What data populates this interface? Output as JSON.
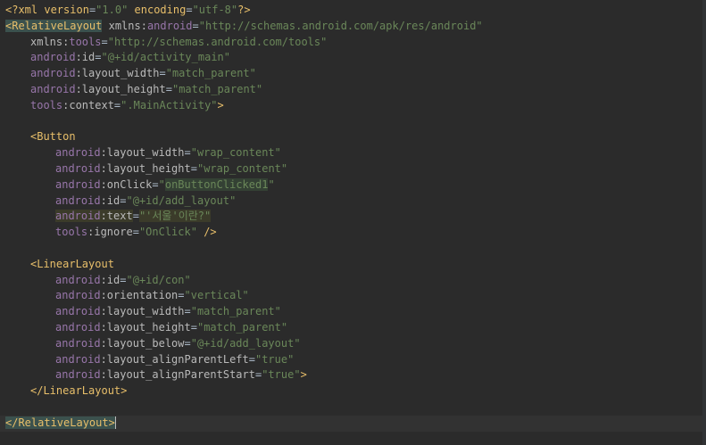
{
  "editor": {
    "lines": [
      {
        "indent": 0,
        "tokens": [
          {
            "t": "<?",
            "c": "c-decl"
          },
          {
            "t": "xml version",
            "c": "c-decl"
          },
          {
            "t": "=",
            "c": "c-eq"
          },
          {
            "t": "\"1.0\"",
            "c": "c-str"
          },
          {
            "t": " encoding",
            "c": "c-decl"
          },
          {
            "t": "=",
            "c": "c-eq"
          },
          {
            "t": "\"utf-8\"",
            "c": "c-str"
          },
          {
            "t": "?>",
            "c": "c-decl"
          }
        ]
      },
      {
        "indent": 0,
        "tokens": [
          {
            "t": "<RelativeLayout",
            "c": "c-tag hl-tag"
          },
          {
            "t": " xmlns:",
            "c": "c-attr"
          },
          {
            "t": "android",
            "c": "c-ns"
          },
          {
            "t": "=",
            "c": "c-eq"
          },
          {
            "t": "\"http://schemas.android.com/apk/res/android\"",
            "c": "c-str"
          }
        ]
      },
      {
        "indent": 1,
        "tokens": [
          {
            "t": "xmlns:",
            "c": "c-attr"
          },
          {
            "t": "tools",
            "c": "c-ns"
          },
          {
            "t": "=",
            "c": "c-eq"
          },
          {
            "t": "\"http://schemas.android.com/tools\"",
            "c": "c-str"
          }
        ]
      },
      {
        "indent": 1,
        "tokens": [
          {
            "t": "android",
            "c": "c-ns"
          },
          {
            "t": ":id",
            "c": "c-attr"
          },
          {
            "t": "=",
            "c": "c-eq"
          },
          {
            "t": "\"@+id/activity_main\"",
            "c": "c-str"
          }
        ]
      },
      {
        "indent": 1,
        "tokens": [
          {
            "t": "android",
            "c": "c-ns"
          },
          {
            "t": ":layout_width",
            "c": "c-attr"
          },
          {
            "t": "=",
            "c": "c-eq"
          },
          {
            "t": "\"match_parent\"",
            "c": "c-str"
          }
        ]
      },
      {
        "indent": 1,
        "tokens": [
          {
            "t": "android",
            "c": "c-ns"
          },
          {
            "t": ":layout_height",
            "c": "c-attr"
          },
          {
            "t": "=",
            "c": "c-eq"
          },
          {
            "t": "\"match_parent\"",
            "c": "c-str"
          }
        ]
      },
      {
        "indent": 1,
        "tokens": [
          {
            "t": "tools",
            "c": "c-ns"
          },
          {
            "t": ":context",
            "c": "c-attr"
          },
          {
            "t": "=",
            "c": "c-eq"
          },
          {
            "t": "\".MainActivity\"",
            "c": "c-str"
          },
          {
            "t": ">",
            "c": "c-punct"
          }
        ]
      },
      {
        "indent": 0,
        "tokens": []
      },
      {
        "indent": 1,
        "tokens": [
          {
            "t": "<Button",
            "c": "c-tag"
          }
        ]
      },
      {
        "indent": 2,
        "tokens": [
          {
            "t": "android",
            "c": "c-ns"
          },
          {
            "t": ":layout_width",
            "c": "c-attr"
          },
          {
            "t": "=",
            "c": "c-eq"
          },
          {
            "t": "\"wrap_content\"",
            "c": "c-str"
          }
        ]
      },
      {
        "indent": 2,
        "tokens": [
          {
            "t": "android",
            "c": "c-ns"
          },
          {
            "t": ":layout_height",
            "c": "c-attr"
          },
          {
            "t": "=",
            "c": "c-eq"
          },
          {
            "t": "\"wrap_content\"",
            "c": "c-str"
          }
        ]
      },
      {
        "indent": 2,
        "tokens": [
          {
            "t": "android",
            "c": "c-ns"
          },
          {
            "t": ":onClick",
            "c": "c-attr"
          },
          {
            "t": "=",
            "c": "c-eq"
          },
          {
            "t": "\"",
            "c": "c-str"
          },
          {
            "t": "onButtonClicked1",
            "c": "c-str c-warn-text"
          },
          {
            "t": "\"",
            "c": "c-str"
          }
        ]
      },
      {
        "indent": 2,
        "tokens": [
          {
            "t": "android",
            "c": "c-ns"
          },
          {
            "t": ":id",
            "c": "c-attr"
          },
          {
            "t": "=",
            "c": "c-eq"
          },
          {
            "t": "\"@+id/add_layout\"",
            "c": "c-str"
          }
        ]
      },
      {
        "indent": 2,
        "tokens": [
          {
            "t": "android",
            "c": "c-ns c-warn-attr"
          },
          {
            "t": ":text",
            "c": "c-attr c-warn-attr"
          },
          {
            "t": "=",
            "c": "c-eq"
          },
          {
            "t": "\"'서울'이란?\"",
            "c": "c-str c-warn-attr"
          }
        ]
      },
      {
        "indent": 2,
        "tokens": [
          {
            "t": "tools",
            "c": "c-ns"
          },
          {
            "t": ":ignore",
            "c": "c-attr"
          },
          {
            "t": "=",
            "c": "c-eq"
          },
          {
            "t": "\"OnClick\"",
            "c": "c-str"
          },
          {
            "t": " />",
            "c": "c-punct"
          }
        ]
      },
      {
        "indent": 0,
        "tokens": []
      },
      {
        "indent": 1,
        "tokens": [
          {
            "t": "<LinearLayout",
            "c": "c-tag"
          }
        ]
      },
      {
        "indent": 2,
        "tokens": [
          {
            "t": "android",
            "c": "c-ns"
          },
          {
            "t": ":id",
            "c": "c-attr"
          },
          {
            "t": "=",
            "c": "c-eq"
          },
          {
            "t": "\"@+id/con\"",
            "c": "c-str"
          }
        ]
      },
      {
        "indent": 2,
        "tokens": [
          {
            "t": "android",
            "c": "c-ns"
          },
          {
            "t": ":orientation",
            "c": "c-attr"
          },
          {
            "t": "=",
            "c": "c-eq"
          },
          {
            "t": "\"vertical\"",
            "c": "c-str"
          }
        ]
      },
      {
        "indent": 2,
        "tokens": [
          {
            "t": "android",
            "c": "c-ns"
          },
          {
            "t": ":layout_width",
            "c": "c-attr"
          },
          {
            "t": "=",
            "c": "c-eq"
          },
          {
            "t": "\"match_parent\"",
            "c": "c-str"
          }
        ]
      },
      {
        "indent": 2,
        "tokens": [
          {
            "t": "android",
            "c": "c-ns"
          },
          {
            "t": ":layout_height",
            "c": "c-attr"
          },
          {
            "t": "=",
            "c": "c-eq"
          },
          {
            "t": "\"match_parent\"",
            "c": "c-str"
          }
        ]
      },
      {
        "indent": 2,
        "tokens": [
          {
            "t": "android",
            "c": "c-ns"
          },
          {
            "t": ":layout_below",
            "c": "c-attr"
          },
          {
            "t": "=",
            "c": "c-eq"
          },
          {
            "t": "\"@+id/add_layout\"",
            "c": "c-str"
          }
        ]
      },
      {
        "indent": 2,
        "tokens": [
          {
            "t": "android",
            "c": "c-ns"
          },
          {
            "t": ":layout_alignParentLeft",
            "c": "c-attr"
          },
          {
            "t": "=",
            "c": "c-eq"
          },
          {
            "t": "\"true\"",
            "c": "c-str"
          }
        ]
      },
      {
        "indent": 2,
        "tokens": [
          {
            "t": "android",
            "c": "c-ns"
          },
          {
            "t": ":layout_alignParentStart",
            "c": "c-attr"
          },
          {
            "t": "=",
            "c": "c-eq"
          },
          {
            "t": "\"true\"",
            "c": "c-str"
          },
          {
            "t": ">",
            "c": "c-punct"
          }
        ]
      },
      {
        "indent": 1,
        "tokens": [
          {
            "t": "</LinearLayout>",
            "c": "c-tag"
          }
        ]
      },
      {
        "indent": 0,
        "tokens": []
      },
      {
        "indent": 0,
        "current": true,
        "tokens": [
          {
            "t": "</RelativeLayout",
            "c": "c-tag hl-tag"
          },
          {
            "t": ">",
            "c": "c-tag hl-tag"
          }
        ]
      }
    ]
  },
  "colors": {
    "background": "#2b2b2b",
    "tag": "#e8bf6a",
    "namespace": "#9876aa",
    "attribute": "#bababa",
    "string": "#6a8759",
    "current_line": "#323232"
  }
}
